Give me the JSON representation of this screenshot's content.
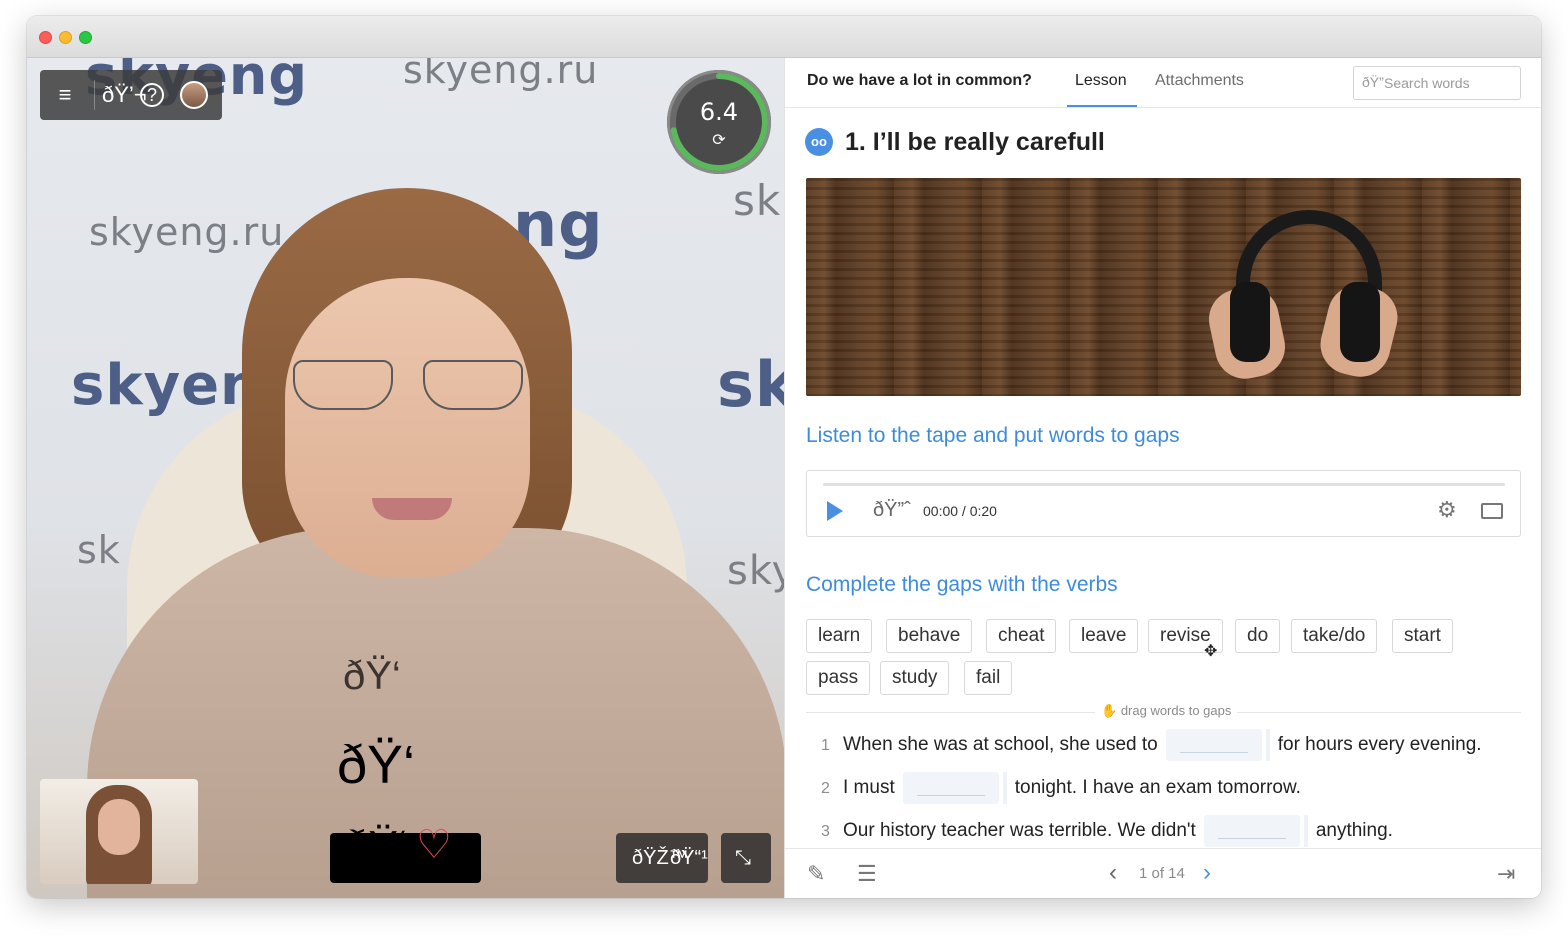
{
  "window": {
    "title": ""
  },
  "video": {
    "watermarks": [
      "skyeng",
      "skyeng.ru",
      "skyeng.ru",
      "skyeng",
      "skyen",
      "sk",
      "sk",
      "sk",
      "sky",
      "ng",
      "k"
    ],
    "score": {
      "value": "6.4",
      "progress_fraction": 0.72
    },
    "topbar": {
      "menu_icon": "menu-icon",
      "chat_icon": "chat-icon",
      "help_icon": "help-icon"
    },
    "reactions": [
      "thumbs-up",
      "heart"
    ],
    "controls": {
      "mic_icon": "mic-icon",
      "camera_icon": "camera-icon",
      "minimize_icon": "minimize-icon"
    }
  },
  "panel": {
    "title": "Do we have a lot in common?",
    "tabs": [
      {
        "label": "Lesson",
        "active": true
      },
      {
        "label": "Attachments",
        "active": false
      }
    ],
    "search": {
      "placeholder": "Search words",
      "value": ""
    },
    "lesson": {
      "icon_text": "ðŸ‘“",
      "title": "1. I’ll be really carefull"
    },
    "section1": "Listen to the tape and put words to gaps",
    "player": {
      "time": "00:00 / 0:20",
      "progress": 0
    },
    "section2": "Complete the gaps with the verbs",
    "words": [
      "learn",
      "behave",
      "cheat",
      "leave",
      "revise",
      "do",
      "take/do",
      "start",
      "pass",
      "study",
      "fail"
    ],
    "hint": "drag words to gaps",
    "questions": [
      {
        "num": "1",
        "before": "When she was at school, she used to",
        "after": "for hours every evening."
      },
      {
        "num": "2",
        "before": "I must",
        "after": "tonight. I have an exam tomorrow."
      },
      {
        "num": "3",
        "before": "Our history teacher was terrible. We didn't",
        "after": "anything."
      }
    ],
    "pager": {
      "text": "1 of 14"
    }
  },
  "colors": {
    "accent": "#4a90e2",
    "section": "#3d8cdc",
    "score_ring": "#5cb85c"
  }
}
